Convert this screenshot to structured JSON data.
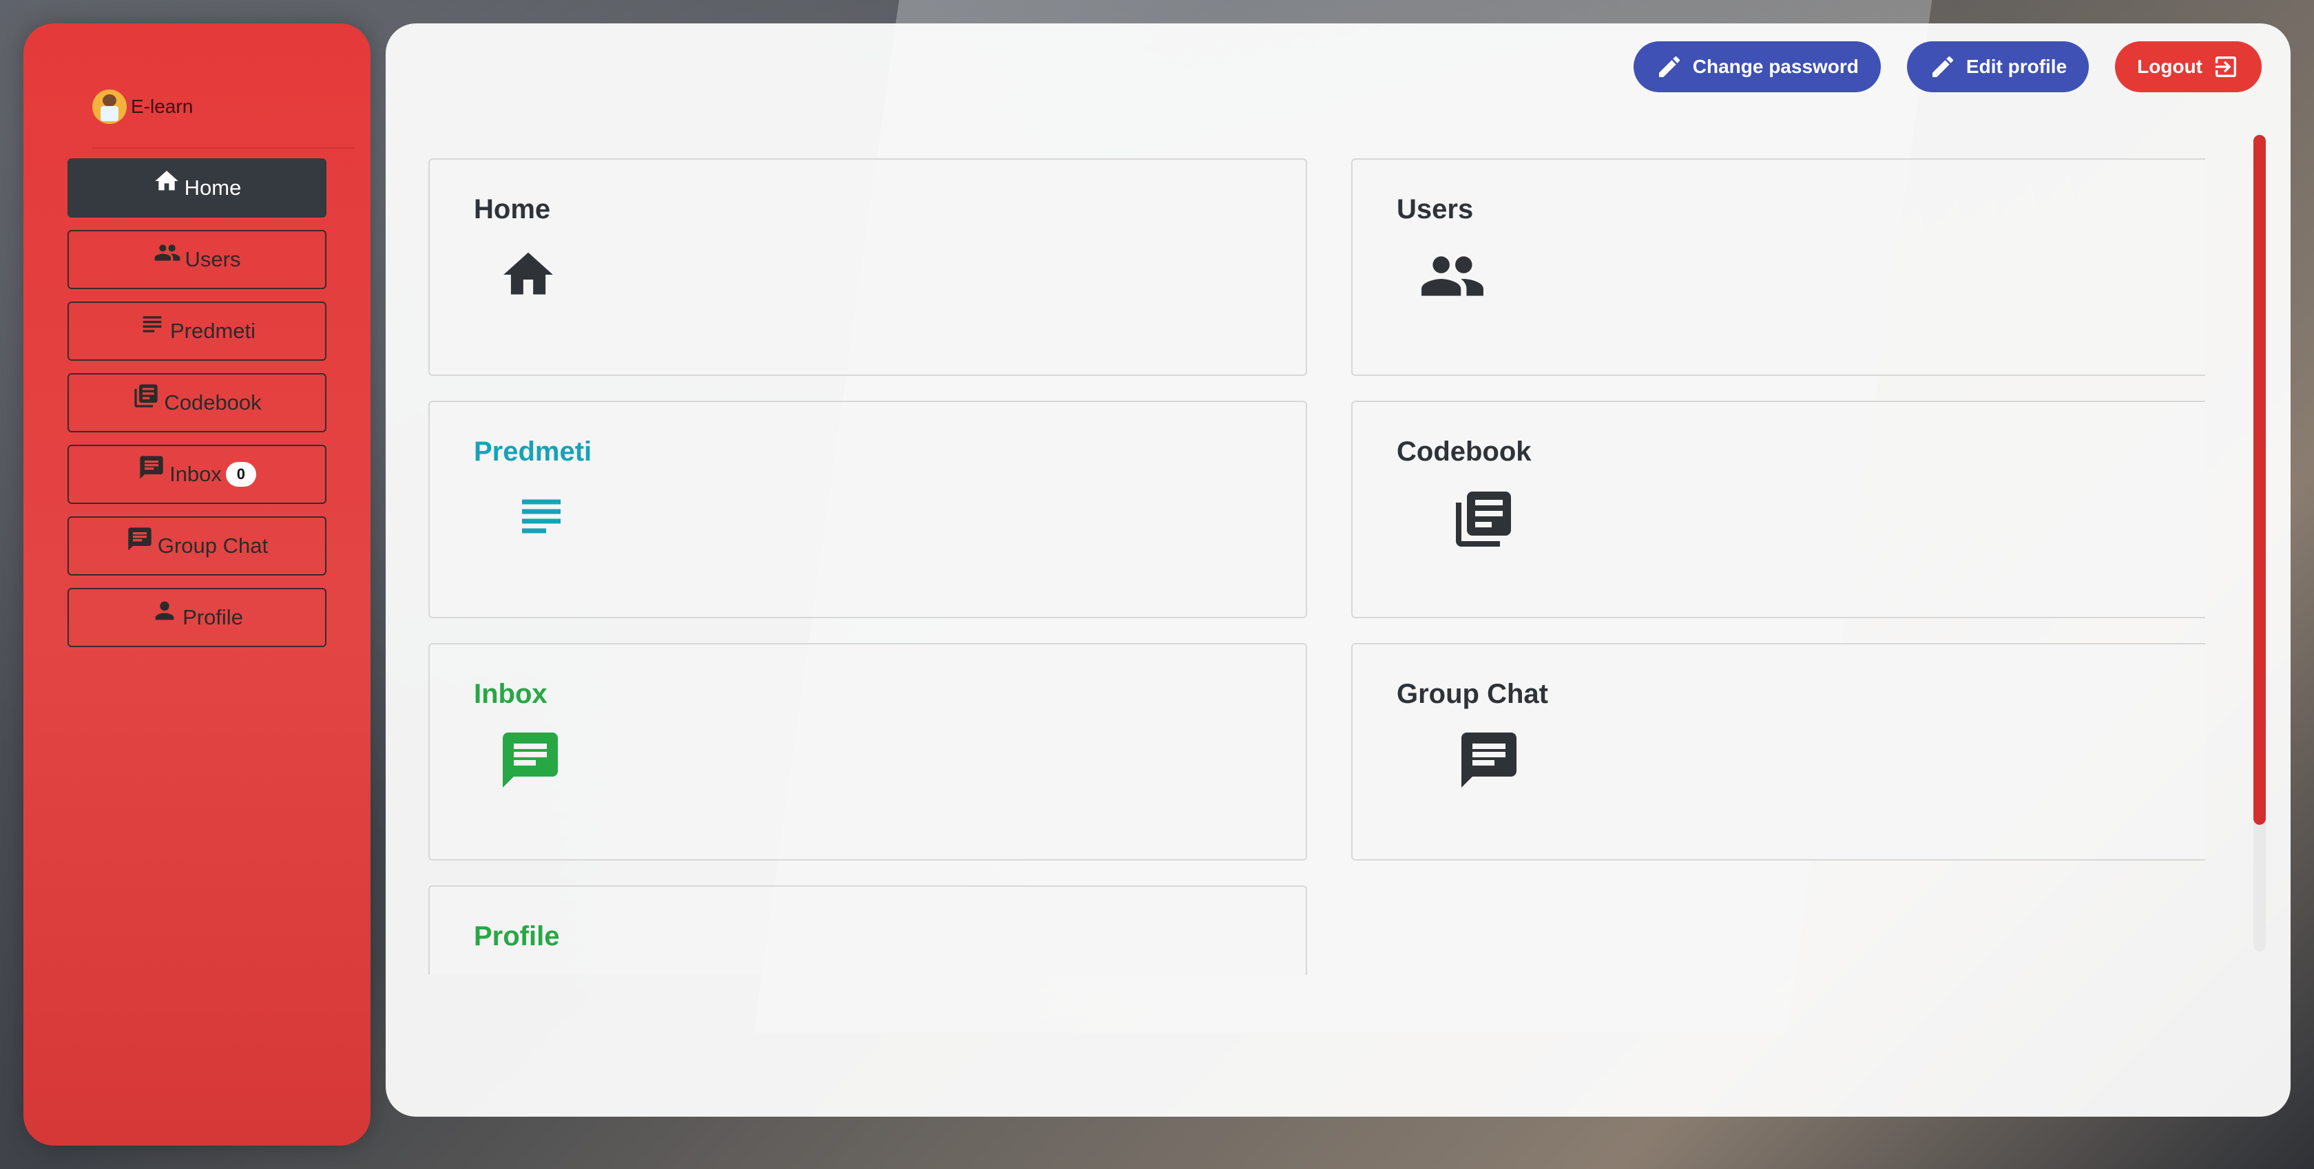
{
  "brand": {
    "name": "E-learn"
  },
  "sidebar": {
    "items": [
      {
        "label": "Home",
        "icon": "home-icon",
        "active": true
      },
      {
        "label": "Users",
        "icon": "users-icon"
      },
      {
        "label": "Predmeti",
        "icon": "subject-icon"
      },
      {
        "label": "Codebook",
        "icon": "library-books-icon"
      },
      {
        "label": "Inbox",
        "icon": "chat-icon",
        "badge": "0"
      },
      {
        "label": "Group Chat",
        "icon": "chat-icon"
      },
      {
        "label": "Profile",
        "icon": "person-icon"
      }
    ]
  },
  "topbar": {
    "change_password": "Change password",
    "edit_profile": "Edit profile",
    "logout": "Logout"
  },
  "cards": [
    {
      "title": "Home",
      "color": "#2f3338",
      "icon": "home-icon"
    },
    {
      "title": "Users",
      "color": "#2f3338",
      "icon": "users-icon"
    },
    {
      "title": "Predmeti",
      "color": "#17a2b8",
      "icon": "subject-icon"
    },
    {
      "title": "Codebook",
      "color": "#2f3338",
      "icon": "library-books-icon"
    },
    {
      "title": "Inbox",
      "color": "#28a745",
      "icon": "chat-icon"
    },
    {
      "title": "Group Chat",
      "color": "#2f3338",
      "icon": "chat-icon"
    },
    {
      "title": "Profile",
      "color": "#28a745",
      "icon": "person-icon"
    }
  ],
  "colors": {
    "sidebar": "#e53a3a",
    "active": "#343a40",
    "primary": "#3f51b5",
    "danger": "#e53935"
  }
}
